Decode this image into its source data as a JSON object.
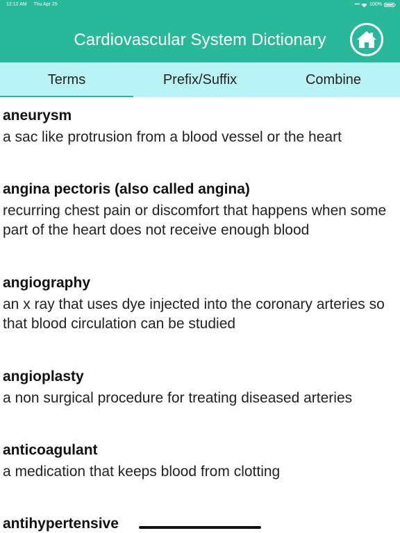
{
  "status_bar": {
    "time": "12:12 AM",
    "date": "Thu Apr 25",
    "battery": "100%"
  },
  "header": {
    "title": "Cardiovascular System Dictionary",
    "home_icon": "home-icon"
  },
  "colors": {
    "header_bg": "#29b99a",
    "tab_bg": "#b9f3f6",
    "tab_indicator": "#29b99a"
  },
  "tabs": [
    {
      "label": "Terms",
      "active": true
    },
    {
      "label": "Prefix/Suffix",
      "active": false
    },
    {
      "label": "Combine",
      "active": false
    }
  ],
  "terms": [
    {
      "name": "aneurysm",
      "definition": "a sac like protrusion from a blood vessel or the heart"
    },
    {
      "name": "angina pectoris (also called angina)",
      "definition": "recurring chest pain or discomfort that happens when some part of the heart does not receive enough blood"
    },
    {
      "name": "angiography",
      "definition": "an x ray that uses dye injected into the coronary arteries so that blood circulation can be studied"
    },
    {
      "name": "angioplasty",
      "definition": "a non surgical procedure for treating diseased arteries"
    },
    {
      "name": "anticoagulant",
      "definition": "a medication that keeps blood from clotting"
    },
    {
      "name": "antihypertensive",
      "definition": ""
    }
  ]
}
